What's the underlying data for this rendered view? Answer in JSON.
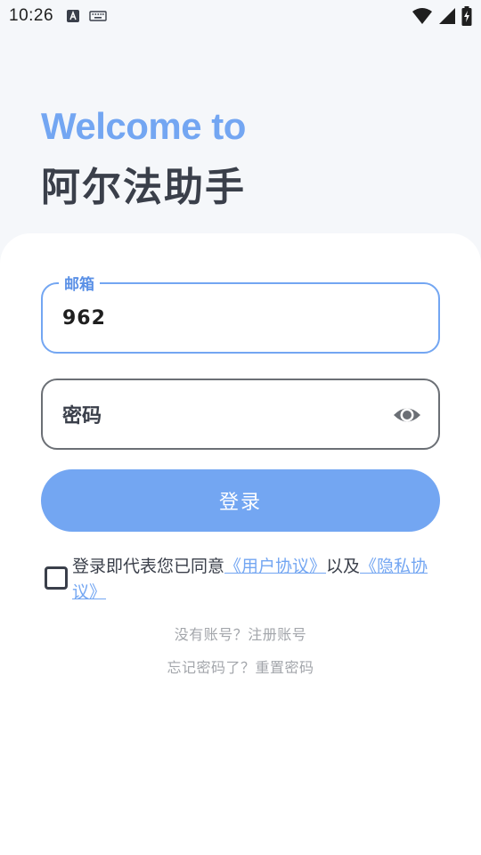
{
  "status_bar": {
    "time": "10:26"
  },
  "header": {
    "welcome": "Welcome to",
    "app_name": "阿尔法助手"
  },
  "email_field": {
    "label": "邮箱",
    "value": "962"
  },
  "password_field": {
    "placeholder": "密码"
  },
  "login_button": {
    "label": "登录"
  },
  "agreement": {
    "prefix": "登录即代表您已同意",
    "user_agreement": "《用户协议》",
    "middle": "以及",
    "privacy_policy": "《隐私协议》"
  },
  "links": {
    "register": "没有账号？注册账号",
    "reset": "忘记密码了？重置密码"
  },
  "colors": {
    "accent": "#73a6f2",
    "text_dark": "#3a3f4a",
    "muted": "#a3a6ab"
  }
}
